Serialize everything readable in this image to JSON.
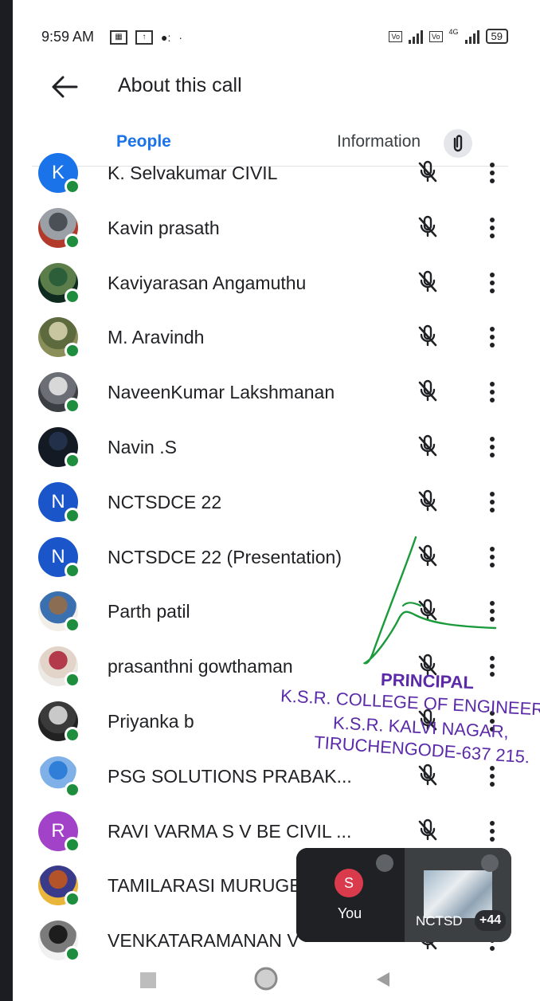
{
  "status_bar": {
    "time": "9:59 AM",
    "icons": [
      "calendar-notification-icon",
      "upload-icon",
      "chat-icon",
      "dot-icon"
    ],
    "battery_level": "59",
    "network_label": "4G"
  },
  "header": {
    "title": "About this call"
  },
  "tabs": {
    "people_label": "People",
    "information_label": "Information"
  },
  "participants": [
    {
      "name": "K. Selvakumar CIVIL",
      "avatar_type": "letter",
      "initial": "K",
      "color": "#1a73e8"
    },
    {
      "name": "Kavin prasath",
      "avatar_type": "photo",
      "colors": [
        "#b33a2a",
        "#4b4f56",
        "#9aa0a6"
      ]
    },
    {
      "name": "Kaviyarasan Angamuthu",
      "avatar_type": "photo",
      "colors": [
        "#0f2a1f",
        "#2c5e3a",
        "#5a7d4a"
      ]
    },
    {
      "name": "M. Aravindh",
      "avatar_type": "photo",
      "colors": [
        "#8a8f5a",
        "#c7c6a0",
        "#5c6a3e"
      ]
    },
    {
      "name": "NaveenKumar Lakshmanan",
      "avatar_type": "photo",
      "colors": [
        "#3b3f44",
        "#d8d8d8",
        "#6b6f75"
      ]
    },
    {
      "name": "Navin .S",
      "avatar_type": "photo",
      "colors": [
        "#141a24",
        "#22304a",
        "#141a24"
      ]
    },
    {
      "name": "NCTSDCE 22",
      "avatar_type": "letter",
      "initial": "N",
      "color": "#1a55c9"
    },
    {
      "name": "NCTSDCE 22 (Presentation)",
      "avatar_type": "letter",
      "initial": "N",
      "color": "#1a55c9"
    },
    {
      "name": "Parth patil",
      "avatar_type": "photo",
      "colors": [
        "#f2efe9",
        "#8a6d52",
        "#3a6fb0"
      ]
    },
    {
      "name": "prasanthni gowthaman",
      "avatar_type": "photo",
      "colors": [
        "#ece9e4",
        "#b33a4a",
        "#e2d4c8"
      ]
    },
    {
      "name": "Priyanka b",
      "avatar_type": "photo",
      "colors": [
        "#222",
        "#c9c9c9",
        "#3a3a3a"
      ]
    },
    {
      "name": "PSG SOLUTIONS PRABAK...",
      "avatar_type": "photo",
      "colors": [
        "#ffffff",
        "#2f7fd8",
        "#7fb0e8"
      ]
    },
    {
      "name": "RAVI VARMA S V BE CIVIL ...",
      "avatar_type": "letter",
      "initial": "R",
      "color": "#a142c9"
    },
    {
      "name": "TAMILARASI MURUGESAN",
      "avatar_type": "photo",
      "colors": [
        "#e9b53a",
        "#b3532a",
        "#3a3a8a"
      ]
    },
    {
      "name": "VENKATARAMANAN V",
      "avatar_type": "photo",
      "colors": [
        "#f1f1f1",
        "#1d1d1d",
        "#7b7b7b"
      ]
    }
  ],
  "preview": {
    "self_initial": "S",
    "self_label": "You",
    "other_label": "NCTSD",
    "more_count": "+44"
  },
  "stamp": {
    "line1": "PRINCIPAL",
    "line2": "K.S.R. COLLEGE OF ENGINEERING",
    "line3": "K.S.R. KALVI NAGAR,",
    "line4": "TIRUCHENGODE-637 215."
  },
  "colors": {
    "accent": "#1a73e8",
    "online": "#1e8e3e",
    "stamp": "#5a2aa8",
    "signature": "#1a9a3a"
  }
}
